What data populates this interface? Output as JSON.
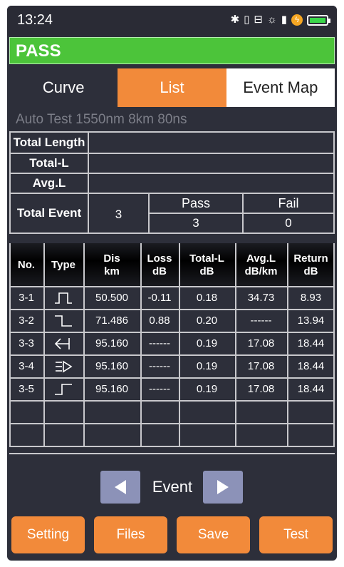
{
  "status_bar": {
    "time": "13:24"
  },
  "result": "PASS",
  "tabs": {
    "curve": "Curve",
    "list": "List",
    "event_map": "Event Map"
  },
  "test_info": "Auto Test  1550nm  8km  80ns",
  "summary": {
    "total_length_label": "Total Length",
    "total_l_label": "Total-L",
    "avg_l_label": "Avg.L",
    "total_event_label": "Total Event",
    "total_event_value": "3",
    "pass_label": "Pass",
    "fail_label": "Fail",
    "pass_value": "3",
    "fail_value": "0"
  },
  "event_table": {
    "headers": [
      "No.",
      "Type",
      "Dis\nkm",
      "Loss\ndB",
      "Total-L\ndB",
      "Avg.L\ndB/km",
      "Return\ndB"
    ],
    "rows": [
      {
        "no": "3-1",
        "type": "reflective-event-icon",
        "dis": "50.500",
        "loss": "-0.11",
        "total_l": "0.18",
        "avg_l": "34.73",
        "ret": "8.93"
      },
      {
        "no": "3-2",
        "type": "fiber-end-icon",
        "dis": "71.486",
        "loss": "0.88",
        "total_l": "0.20",
        "avg_l": "------",
        "ret": "13.94"
      },
      {
        "no": "3-3",
        "type": "start-arrow-icon",
        "dis": "95.160",
        "loss": "------",
        "total_l": "0.19",
        "avg_l": "17.08",
        "ret": "18.44"
      },
      {
        "no": "3-4",
        "type": "end-arrow-icon",
        "dis": "95.160",
        "loss": "------",
        "total_l": "0.19",
        "avg_l": "17.08",
        "ret": "18.44"
      },
      {
        "no": "3-5",
        "type": "gain-event-icon",
        "dis": "95.160",
        "loss": "------",
        "total_l": "0.19",
        "avg_l": "17.08",
        "ret": "18.44"
      }
    ]
  },
  "event_nav": {
    "label": "Event"
  },
  "buttons": {
    "setting": "Setting",
    "files": "Files",
    "save": "Save",
    "test": "Test"
  },
  "colors": {
    "accent": "#f28a3a",
    "pass": "#4cc43a",
    "background": "#2d2f3a",
    "nav_button": "#8c92b8"
  }
}
